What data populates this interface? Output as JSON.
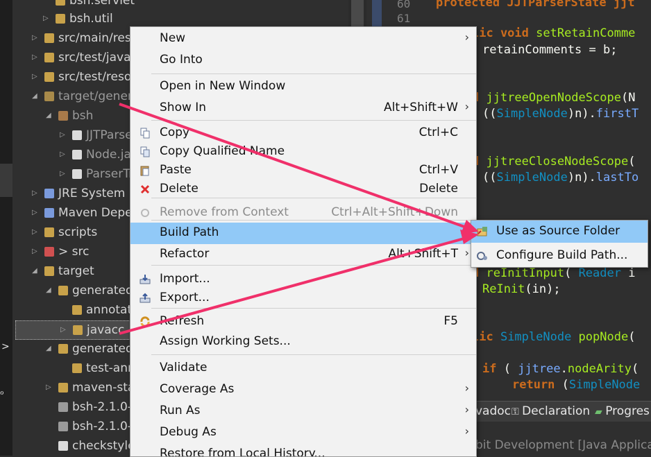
{
  "explorer": {
    "rows": [
      {
        "text": "bsh.servlet",
        "dim": false
      },
      {
        "text": "bsh.util",
        "dim": false
      },
      {
        "text": "src/main/reso",
        "dim": false
      },
      {
        "text": "src/test/java",
        "dim": false
      },
      {
        "text": "src/test/reso",
        "dim": false
      },
      {
        "text": "target/gener",
        "dim": true
      },
      {
        "text": "bsh",
        "dim": true
      },
      {
        "text": "JJTParser",
        "dim": true
      },
      {
        "text": "Node.java",
        "dim": true
      },
      {
        "text": "ParserTr",
        "dim": true
      },
      {
        "text": "JRE System L",
        "dim": false
      },
      {
        "text": "Maven Depe",
        "dim": false
      },
      {
        "text": "scripts",
        "dim": false
      },
      {
        "text": "> src",
        "dim": false
      },
      {
        "text": "target",
        "dim": false
      },
      {
        "text": "generated",
        "dim": false
      },
      {
        "text": "annotat",
        "dim": false
      },
      {
        "text": "javacc",
        "dim": false
      },
      {
        "text": "generated",
        "dim": false
      },
      {
        "text": "test-ann",
        "dim": false
      },
      {
        "text": "maven-sta",
        "dim": false
      },
      {
        "text": "bsh-2.1.0-",
        "dim": false
      },
      {
        "text": "bsh-2.1.0-",
        "dim": false
      },
      {
        "text": "checkstyle",
        "dim": false
      }
    ]
  },
  "editor": {
    "line_numbers": [
      "60",
      "61"
    ],
    "lines": [
      "protected JJTParserState jjt",
      "lic void setRetainComme",
      "retainComments = b;",
      "d jjtreeOpenNodeScope(N",
      "((SimpleNode)n).firstT",
      "d jjtreeCloseNodeScope(",
      "((SimpleNode)n).lastTo",
      "d reInitInput( Reader i",
      "ReInit(in);",
      "lic SimpleNode popNode(",
      "if ( jjtree.nodeArity(",
      "return (SimpleNode"
    ]
  },
  "bottom_panel": {
    "tabs": [
      "vadoc",
      "Declaration",
      "Progres"
    ],
    "content": "bit Development [Java Applicatio"
  },
  "context_menu": {
    "items": [
      {
        "label": "New",
        "shortcut": "",
        "submenu": true,
        "icon": ""
      },
      {
        "label": "Go Into",
        "shortcut": "",
        "submenu": false,
        "icon": ""
      },
      {
        "label": "Open in New Window",
        "shortcut": "",
        "submenu": false,
        "icon": ""
      },
      {
        "label": "Show In",
        "shortcut": "Alt+Shift+W",
        "submenu": true,
        "icon": ""
      },
      {
        "label": "Copy",
        "shortcut": "Ctrl+C",
        "submenu": false,
        "icon": "copy-icon"
      },
      {
        "label": "Copy Qualified Name",
        "shortcut": "",
        "submenu": false,
        "icon": "copy-qualified-name-icon"
      },
      {
        "label": "Paste",
        "shortcut": "Ctrl+V",
        "submenu": false,
        "icon": "paste-icon"
      },
      {
        "label": "Delete",
        "shortcut": "Delete",
        "submenu": false,
        "icon": "delete-icon"
      },
      {
        "label": "Remove from Context",
        "shortcut": "Ctrl+Alt+Shift+Down",
        "submenu": false,
        "icon": "remove-from-context-icon",
        "disabled": true
      },
      {
        "label": "Build Path",
        "shortcut": "",
        "submenu": true,
        "icon": "",
        "highlighted": true
      },
      {
        "label": "Refactor",
        "shortcut": "Alt+Shift+T",
        "submenu": true,
        "icon": ""
      },
      {
        "label": "Import...",
        "shortcut": "",
        "submenu": false,
        "icon": "import-icon"
      },
      {
        "label": "Export...",
        "shortcut": "",
        "submenu": false,
        "icon": "export-icon"
      },
      {
        "label": "Refresh",
        "shortcut": "F5",
        "submenu": false,
        "icon": "refresh-icon"
      },
      {
        "label": "Assign Working Sets...",
        "shortcut": "",
        "submenu": false,
        "icon": ""
      },
      {
        "label": "Validate",
        "shortcut": "",
        "submenu": false,
        "icon": ""
      },
      {
        "label": "Coverage As",
        "shortcut": "",
        "submenu": true,
        "icon": ""
      },
      {
        "label": "Run As",
        "shortcut": "",
        "submenu": true,
        "icon": ""
      },
      {
        "label": "Debug As",
        "shortcut": "",
        "submenu": true,
        "icon": ""
      },
      {
        "label": "Restore from Local History...",
        "shortcut": "",
        "submenu": false,
        "icon": ""
      }
    ]
  },
  "submenu": {
    "items": [
      {
        "label": "Use as Source Folder",
        "highlighted": true
      },
      {
        "label": "Configure Build Path..."
      }
    ]
  },
  "colors": {
    "menu_highlight": "#91c9f7",
    "annotation_arrow": "#f0306a",
    "delete_icon": "#e03030"
  }
}
